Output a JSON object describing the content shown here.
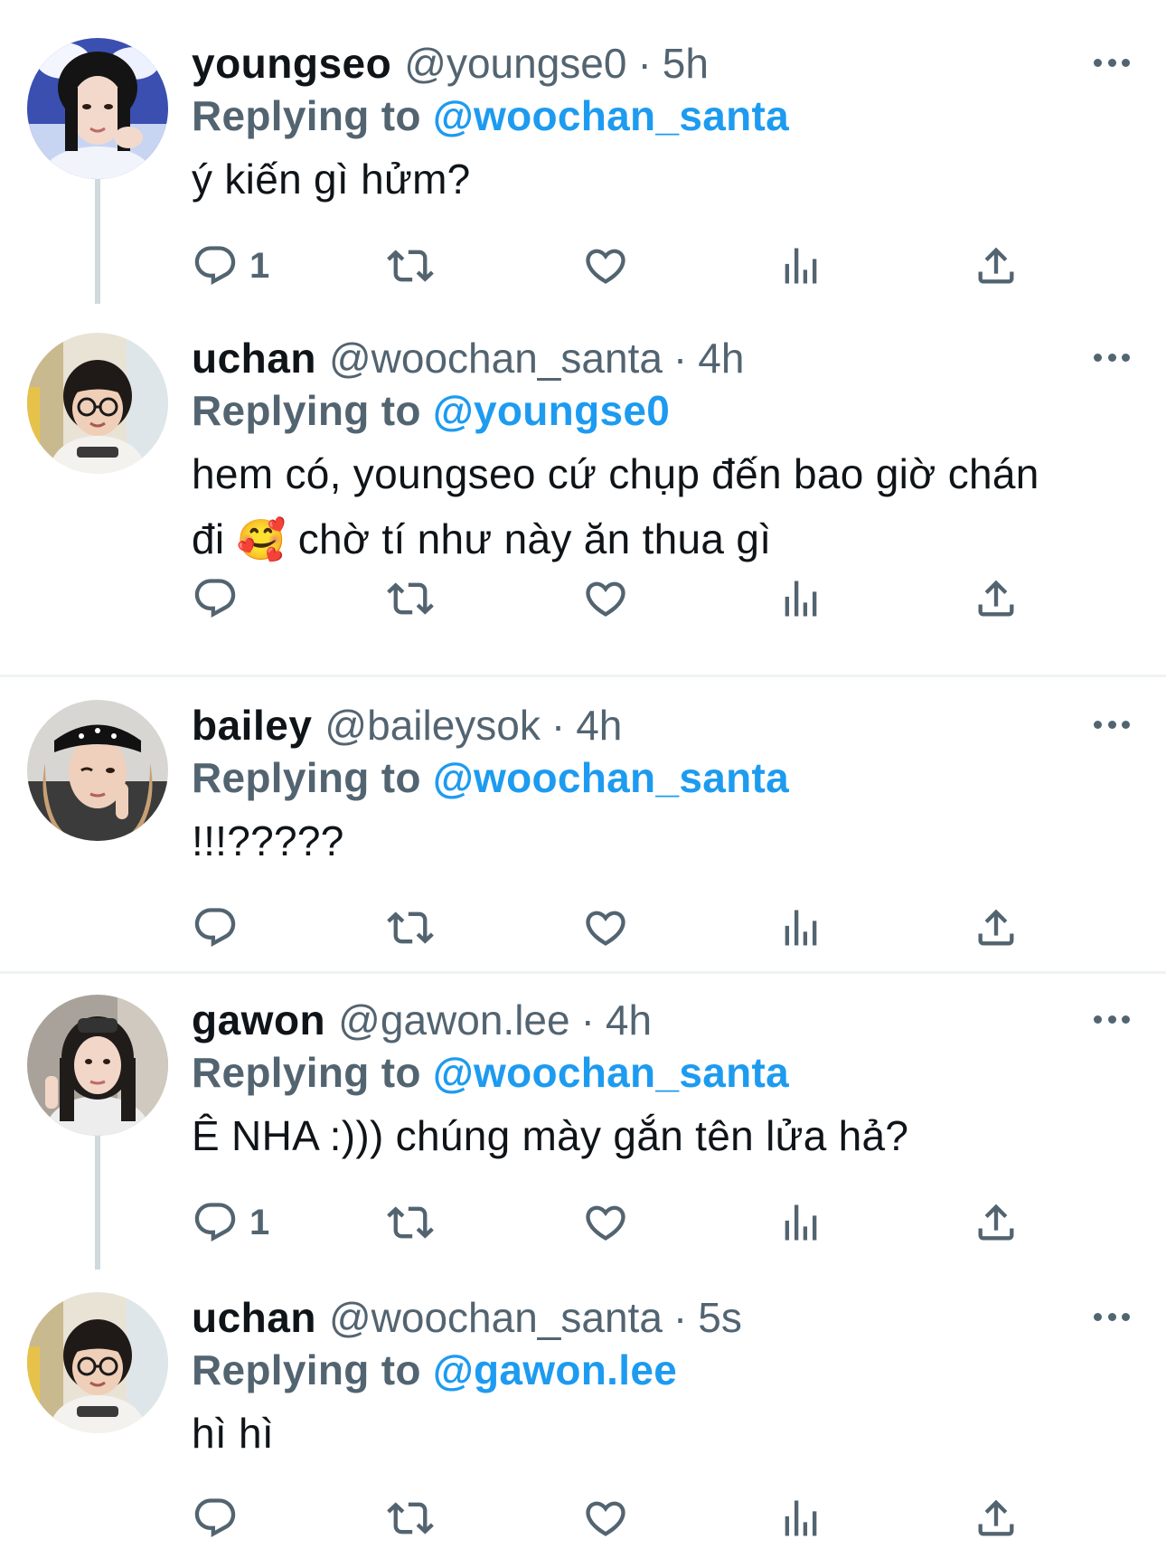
{
  "tweets": [
    {
      "name": "youngseo",
      "handle": "@youngse0",
      "time": "5h",
      "replying_label": "Replying to",
      "replying_to": "@woochan_santa",
      "text": "ý kiến gì hửm?",
      "reply_count": "1",
      "avatar": "youngseo-avatar"
    },
    {
      "name": "uchan",
      "handle": "@woochan_santa",
      "time": "4h",
      "replying_label": "Replying to",
      "replying_to": "@youngse0",
      "text_line1": "hem có, youngseo cứ chụp đến bao giờ chán",
      "text_line2_a": "đi",
      "emoji": "🥰",
      "text_line2_b": "chờ tí như này ăn thua gì",
      "avatar": "uchan-avatar"
    },
    {
      "name": "bailey",
      "handle": "@baileysok",
      "time": "4h",
      "replying_label": "Replying to",
      "replying_to": "@woochan_santa",
      "text": "!!!?????",
      "avatar": "bailey-avatar"
    },
    {
      "name": "gawon",
      "handle": "@gawon.lee",
      "time": "4h",
      "replying_label": "Replying to",
      "replying_to": "@woochan_santa",
      "text": "Ê NHA :))) chúng mày gắn tên lửa hả?",
      "reply_count": "1",
      "avatar": "gawon-avatar"
    },
    {
      "name": "uchan",
      "handle": "@woochan_santa",
      "time": "5s",
      "replying_label": "Replying to",
      "replying_to": "@gawon.lee",
      "text": "hì hì",
      "avatar": "uchan-avatar"
    }
  ],
  "separator": "·",
  "icons": {
    "reply": "reply-icon",
    "retweet": "retweet-icon",
    "like": "heart-icon",
    "views": "views-icon",
    "share": "share-icon",
    "more": "more-icon"
  },
  "colors": {
    "link": "#1d9bf0",
    "secondary": "#536471",
    "primary_text": "#0f1419",
    "divider": "#eff3f4",
    "thread_line": "#cfd9de"
  }
}
